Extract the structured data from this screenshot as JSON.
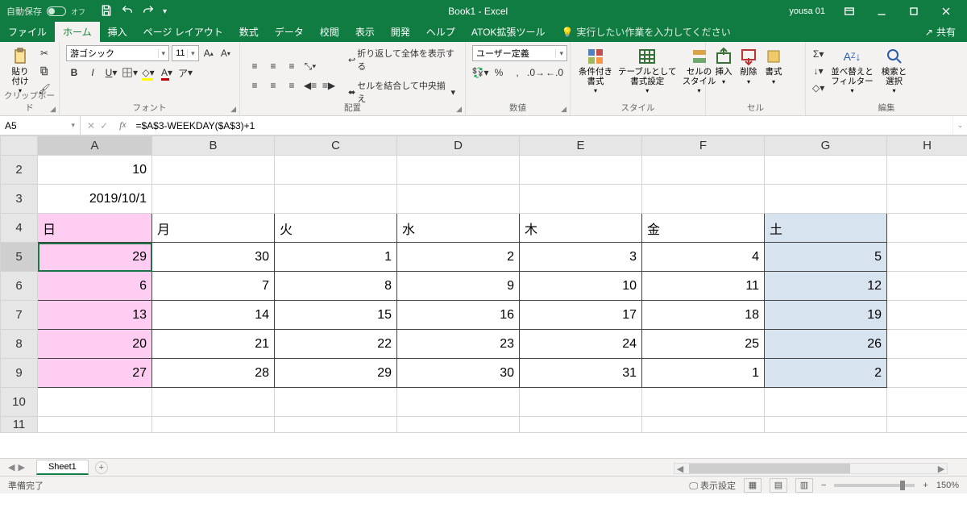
{
  "title": "Book1 - Excel",
  "user": "yousa 01",
  "autosave_label": "自動保存",
  "autosave_state": "オフ",
  "tabs": [
    "ファイル",
    "ホーム",
    "挿入",
    "ページ レイアウト",
    "数式",
    "データ",
    "校閲",
    "表示",
    "開発",
    "ヘルプ",
    "ATOK拡張ツール"
  ],
  "active_tab_index": 1,
  "tell_me": "実行したい作業を入力してください",
  "share": "共有",
  "ribbon": {
    "clipboard": {
      "paste": "貼り付け",
      "label": "クリップボード"
    },
    "font": {
      "name": "游ゴシック",
      "size": "11",
      "label": "フォント"
    },
    "alignment": {
      "wrap": "折り返して全体を表示する",
      "merge": "セルを結合して中央揃え",
      "label": "配置"
    },
    "number": {
      "format": "ユーザー定義",
      "label": "数値"
    },
    "styles": {
      "condfmt": "条件付き\n書式",
      "table": "テーブルとして\n書式設定",
      "cell": "セルの\nスタイル",
      "label": "スタイル"
    },
    "cells": {
      "insert": "挿入",
      "delete": "削除",
      "format": "書式",
      "label": "セル"
    },
    "editing": {
      "sort": "並べ替えと\nフィルター",
      "find": "検索と\n選択",
      "label": "編集"
    }
  },
  "namebox": "A5",
  "formula": "=$A$3-WEEKDAY($A$3)+1",
  "columns": [
    "A",
    "B",
    "C",
    "D",
    "E",
    "F",
    "G",
    "H"
  ],
  "rows": [
    "2",
    "3",
    "4",
    "5",
    "6",
    "7",
    "8",
    "9",
    "10",
    "11"
  ],
  "selected_cell": "A5",
  "cells": {
    "A2": "10",
    "A3": "2019/10/1",
    "A4": "日",
    "B4": "月",
    "C4": "火",
    "D4": "水",
    "E4": "木",
    "F4": "金",
    "G4": "土",
    "A5": "29",
    "B5": "30",
    "C5": "1",
    "D5": "2",
    "E5": "3",
    "F5": "4",
    "G5": "5",
    "A6": "6",
    "B6": "7",
    "C6": "8",
    "D6": "9",
    "E6": "10",
    "F6": "11",
    "G6": "12",
    "A7": "13",
    "B7": "14",
    "C7": "15",
    "D7": "16",
    "E7": "17",
    "F7": "18",
    "G7": "19",
    "A8": "20",
    "B8": "21",
    "C8": "22",
    "D8": "23",
    "E8": "24",
    "F8": "25",
    "G8": "26",
    "A9": "27",
    "B9": "28",
    "C9": "29",
    "D9": "30",
    "E9": "31",
    "F9": "1",
    "G9": "2"
  },
  "sheet_tab": "Sheet1",
  "status_ready": "準備完了",
  "status_display": "表示設定",
  "zoom": "150%"
}
